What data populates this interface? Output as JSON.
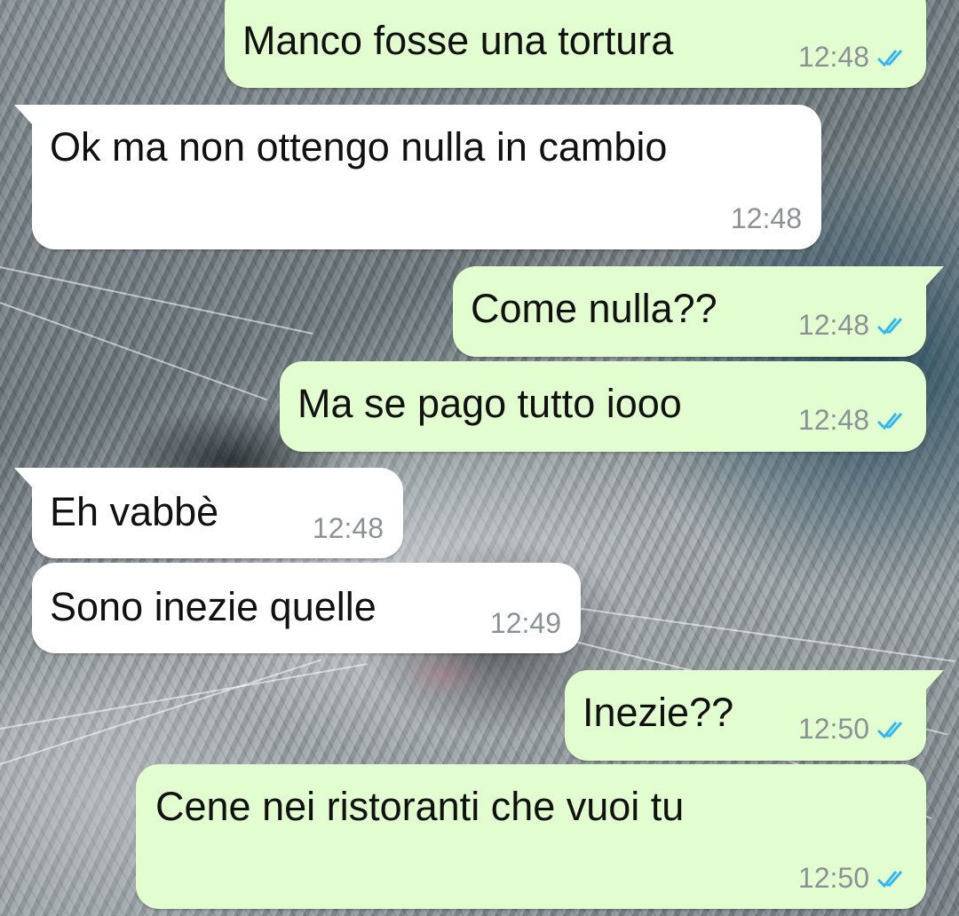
{
  "colors": {
    "outgoing_bubble": "#e2fdcf",
    "incoming_bubble": "#ffffff",
    "time_text": "#8c9196",
    "read_ticks": "#34b7f1"
  },
  "icons": {
    "read_receipt": "double-check-icon"
  },
  "messages": [
    {
      "direction": "outgoing",
      "text": "Manco fosse una tortura",
      "time": "12:48",
      "status": "read"
    },
    {
      "direction": "incoming",
      "text": "Ok ma non ottengo nulla in cambio",
      "time": "12:48"
    },
    {
      "direction": "outgoing",
      "text": "Come nulla??",
      "time": "12:48",
      "status": "read"
    },
    {
      "direction": "outgoing",
      "text": "Ma se pago tutto iooo",
      "time": "12:48",
      "status": "read"
    },
    {
      "direction": "incoming",
      "text": "Eh vabbè",
      "time": "12:48"
    },
    {
      "direction": "incoming",
      "text": "Sono inezie quelle",
      "time": "12:49"
    },
    {
      "direction": "outgoing",
      "text": "Inezie??",
      "time": "12:50",
      "status": "read"
    },
    {
      "direction": "outgoing",
      "text": "Cene nei ristoranti che vuoi tu",
      "time": "12:50",
      "status": "read"
    }
  ]
}
